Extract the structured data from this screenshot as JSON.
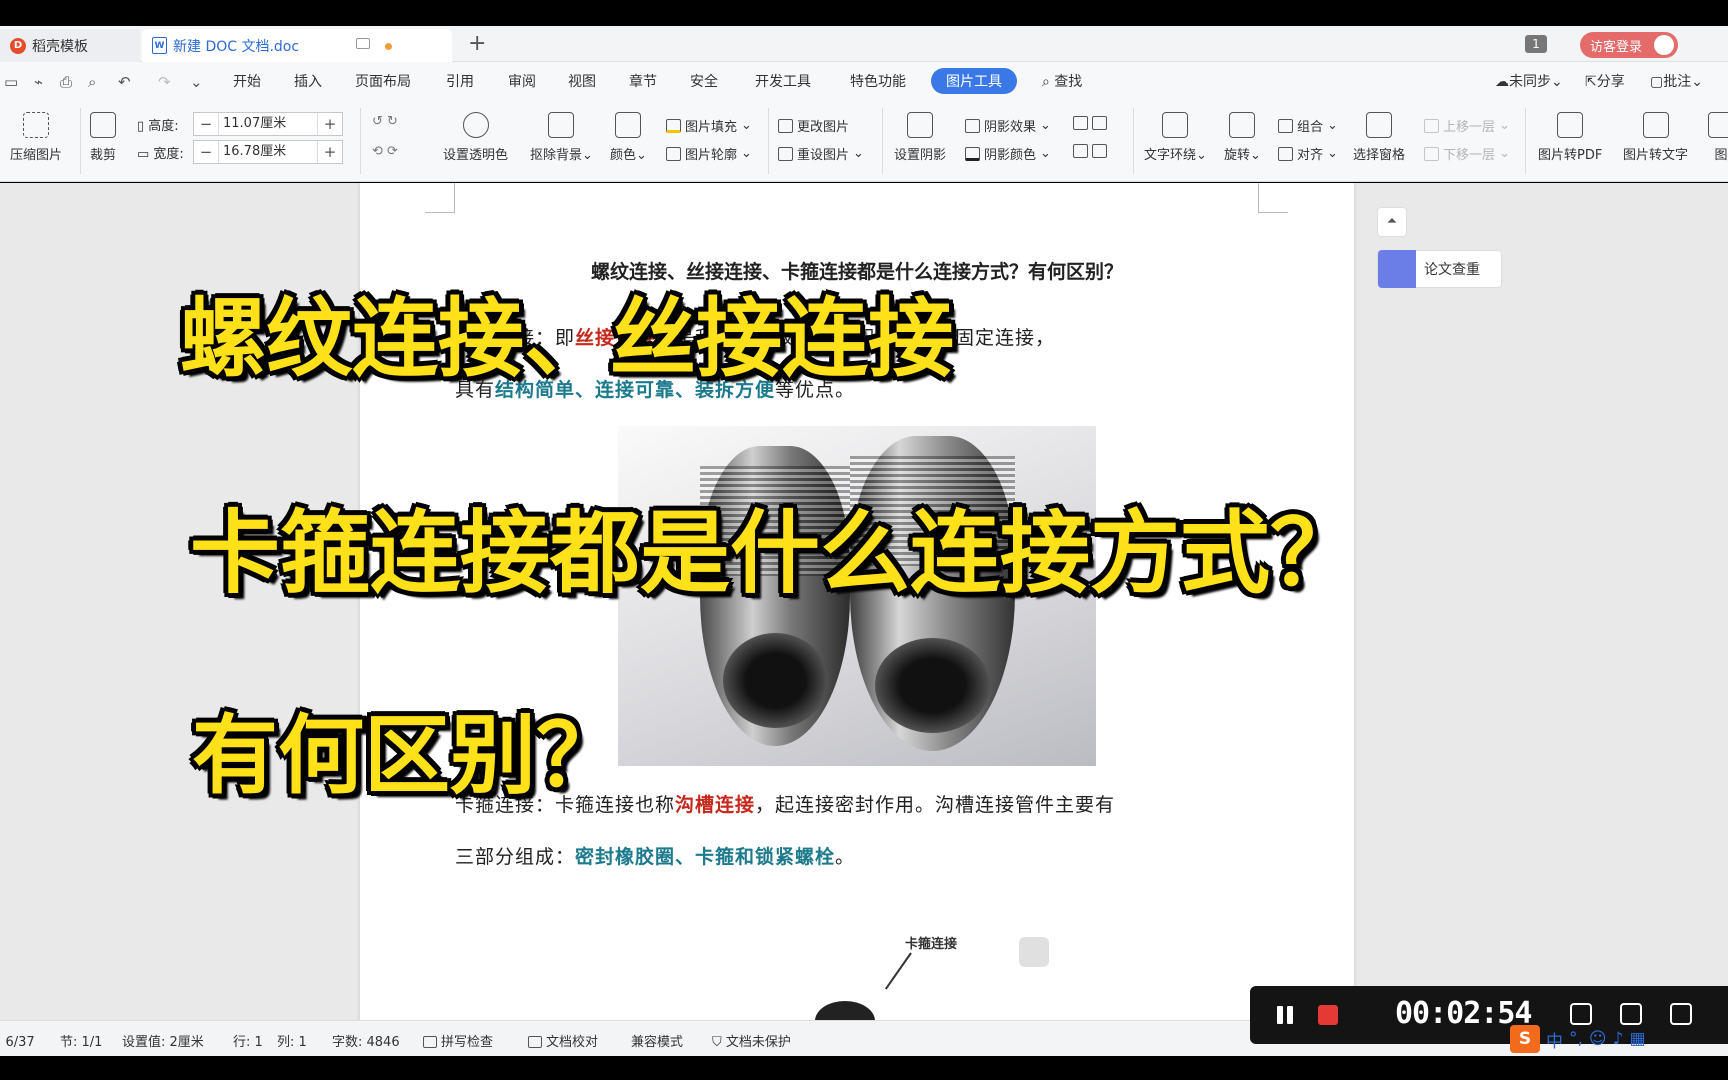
{
  "tabs": {
    "inactive": "稻壳模板",
    "active": "新建 DOC 文档.doc",
    "new_tab": "+",
    "count": "1",
    "login": "访客登录"
  },
  "menu": {
    "items": [
      "开始",
      "插入",
      "页面布局",
      "引用",
      "审阅",
      "视图",
      "章节",
      "安全",
      "开发工具",
      "特色功能",
      "图片工具",
      "查找"
    ],
    "right": [
      "未同步",
      "分享",
      "批注"
    ]
  },
  "ribbon": {
    "compress": "压缩图片",
    "crop": "裁剪",
    "height_label": "高度:",
    "height_value": "11.07厘米",
    "width_label": "宽度:",
    "width_value": "16.78厘米",
    "transparent": "设置透明色",
    "remove_bg": "抠除背景",
    "color": "颜色",
    "fill": "图片填充",
    "outline": "图片轮廓",
    "change": "更改图片",
    "reset": "重设图片",
    "shadow_set": "设置阴影",
    "shadow_effect": "阴影效果",
    "shadow_color": "阴影颜色",
    "wrap": "文字环绕",
    "rotate": "旋转",
    "group": "组合",
    "align": "对齐",
    "select_pane": "选择窗格",
    "bring_forward": "上移一层",
    "send_backward": "下移一层",
    "to_pdf": "图片转PDF",
    "to_text": "图片转文字",
    "more": "图"
  },
  "document": {
    "title": "螺纹连接、丝接连接、卡箍连接都是什么连接方式？有何区别？",
    "p1_a": "螺纹连接：即",
    "p1_red": "丝接连接",
    "p1_b": "，是利用带螺纹的管道配件连接的固定连接，",
    "p2_a": "具有",
    "p2_teal": "结构简单、连接可靠、装拆方便",
    "p2_b": "等优点。",
    "p3_a": "卡箍连接：卡箍连接也称",
    "p3_red": "沟槽连接",
    "p3_b": "，起连接密封作用。沟槽连接管件主要有",
    "p4_a": "三部分组成：",
    "p4_teal": "密封橡胶圈、卡箍和锁紧螺栓",
    "p4_b": "。",
    "diagram_label": "卡箍连接"
  },
  "side_panel": {
    "collapse": "⏶",
    "paper_check": "论文查重"
  },
  "captions": {
    "line1": "螺纹连接、丝接连接",
    "line2": "卡箍连接都是什么连接方式？",
    "line3": "有何区别？"
  },
  "status": {
    "page": "页: 6/37",
    "section": "节: 1/1",
    "setting": "设置值: 2厘米",
    "row": "行: 1",
    "col": "列: 1",
    "words": "字数: 4846",
    "spell": "拼写检查",
    "proof": "文档校对",
    "compat": "兼容模式",
    "protect": "文档未保护"
  },
  "recorder": {
    "time": "00:02:54"
  },
  "ime": {
    "logo": "S",
    "mode": "中"
  }
}
